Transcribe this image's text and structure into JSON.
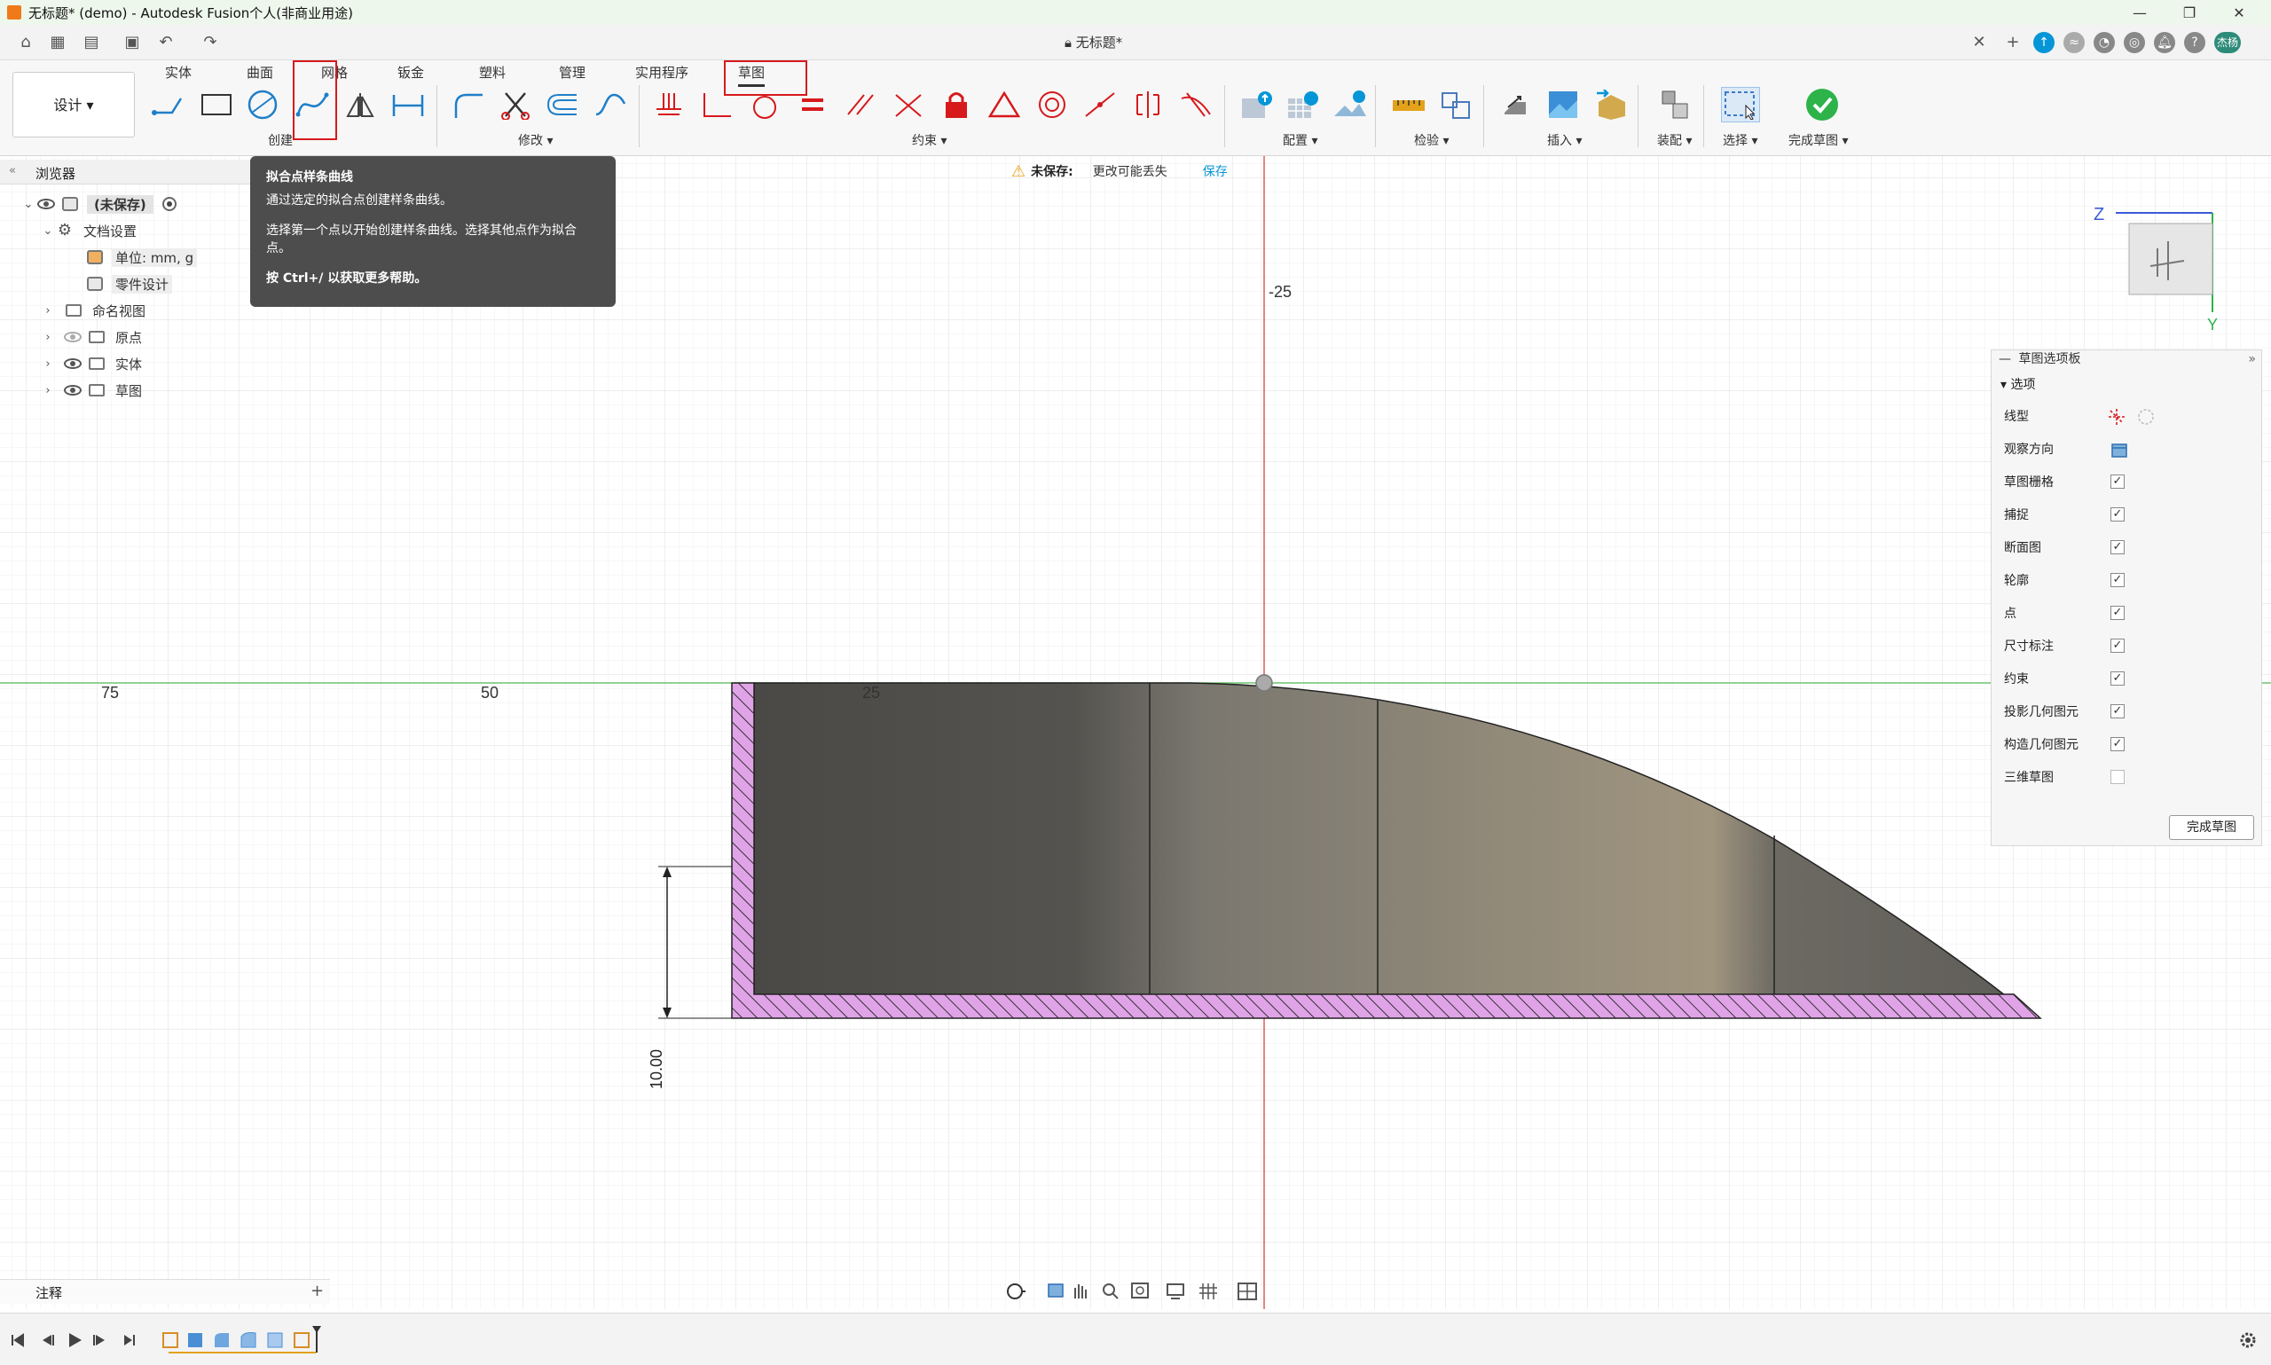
{
  "window": {
    "title": "无标题* (demo) - Autodesk Fusion个人(非商业用途)"
  },
  "document_tab": {
    "label": "无标题*"
  },
  "ribbon": {
    "workspace": "设计",
    "tabs": [
      "实体",
      "曲面",
      "网格",
      "钣金",
      "塑料",
      "管理",
      "实用程序",
      "草图"
    ],
    "active_tab": "草图",
    "groups": {
      "create": "创建",
      "modify": "修改",
      "constraints": "约束",
      "configure": "配置",
      "inspect": "检验",
      "insert": "插入",
      "assemble": "装配",
      "select": "选择",
      "finish": "完成草图"
    }
  },
  "tooltip": {
    "title": "拟合点样条曲线",
    "line1": "通过选定的拟合点创建样条曲线。",
    "line2": "选择第一个点以开始创建样条曲线。选择其他点作为拟合点。",
    "line3": "按 Ctrl+/ 以获取更多帮助。"
  },
  "unsaved": {
    "label": "未保存:",
    "message": "更改可能丢失",
    "save": "保存"
  },
  "browser": {
    "title": "浏览器",
    "root": "(未保存)",
    "doc_settings": "文档设置",
    "units": "单位: mm, g",
    "part_design": "零件设计",
    "named_views": "命名视图",
    "origin": "原点",
    "bodies": "实体",
    "sketches": "草图"
  },
  "canvas": {
    "axis_labels": {
      "minus25": "-25",
      "x75": "75",
      "x50": "50",
      "x25": "25"
    },
    "dimension": "10.00",
    "viewcube": {
      "z": "Z",
      "y": "Y"
    }
  },
  "sketch_palette": {
    "title": "草图选项板",
    "section": "选项",
    "rows": [
      {
        "label": "线型",
        "type": "icons"
      },
      {
        "label": "观察方向",
        "type": "icon"
      },
      {
        "label": "草图栅格",
        "checked": "✓"
      },
      {
        "label": "捕捉",
        "checked": "✓"
      },
      {
        "label": "断面图",
        "checked": "✓"
      },
      {
        "label": "轮廓",
        "checked": "✓"
      },
      {
        "label": "点",
        "checked": "✓"
      },
      {
        "label": "尺寸标注",
        "checked": "✓"
      },
      {
        "label": "约束",
        "checked": "✓"
      },
      {
        "label": "投影几何图元",
        "checked": "✓"
      },
      {
        "label": "构造几何图元",
        "checked": "✓"
      },
      {
        "label": "三维草图",
        "checked": ""
      }
    ],
    "finish_button": "完成草图"
  },
  "notes": {
    "label": "注释"
  },
  "colors": {
    "accent": "#0696d7",
    "red": "#d7191c",
    "hatch": "#e1a3e8",
    "finish_green": "#2db34a"
  },
  "user_avatar": "杰杨"
}
